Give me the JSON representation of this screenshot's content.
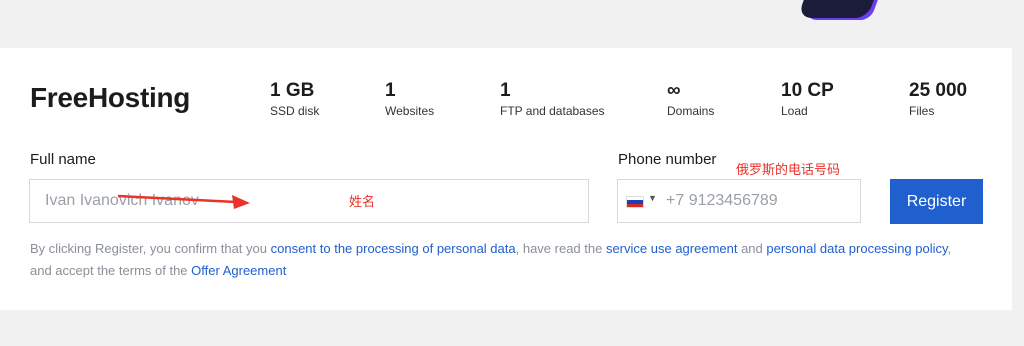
{
  "brand": "FreeHosting",
  "stats": [
    {
      "value": "1 GB",
      "label": "SSD disk"
    },
    {
      "value": "1",
      "label": "Websites"
    },
    {
      "value": "1",
      "label": "FTP and databases"
    },
    {
      "value": "∞",
      "label": "Domains"
    },
    {
      "value": "10 CP",
      "label": "Load"
    },
    {
      "value": "25 000",
      "label": "Files"
    }
  ],
  "form": {
    "full_name_label": "Full name",
    "full_name_placeholder": "Ivan Ivanovich Ivanov",
    "phone_label": "Phone number",
    "phone_placeholder": "+7 9123456789",
    "phone_country": "RU",
    "register_label": "Register"
  },
  "consent": {
    "part1": "By clicking Register, you confirm that you ",
    "link1": "consent to the processing of personal data",
    "part2": ", have read the ",
    "link2": "service use agreement",
    "part3": " and ",
    "link3": "personal data processing policy",
    "part4": ", and accept the terms of the ",
    "link4": "Offer Agreement"
  },
  "annotations": {
    "name_note": "姓名",
    "phone_note": "俄罗斯的电话号码",
    "color": "#e8332a"
  },
  "colors": {
    "accent": "#1f5fce",
    "background": "#f1f1f2",
    "card": "#ffffff"
  }
}
